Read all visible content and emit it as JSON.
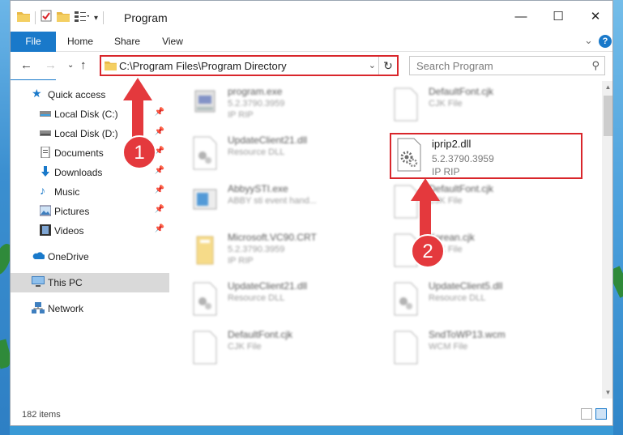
{
  "window": {
    "title": "Program",
    "controls": {
      "minimize": "—",
      "maximize": "☐",
      "close": "✕"
    }
  },
  "ribbon": {
    "tabs": [
      "File",
      "Home",
      "Share",
      "View"
    ],
    "help": "?"
  },
  "nav": {
    "address": "C:\\Program Files\\Program Directory",
    "search_placeholder": "Search Program"
  },
  "sidebar": {
    "items": [
      {
        "label": "Quick access",
        "icon": "star-icon"
      },
      {
        "label": "Local Disk (C:)",
        "icon": "drive-icon"
      },
      {
        "label": "Local Disk (D:)",
        "icon": "drive-icon"
      },
      {
        "label": "Documents",
        "icon": "documents-icon"
      },
      {
        "label": "Downloads",
        "icon": "download-icon"
      },
      {
        "label": "Music",
        "icon": "music-icon"
      },
      {
        "label": "Pictures",
        "icon": "pictures-icon"
      },
      {
        "label": "Videos",
        "icon": "videos-icon"
      },
      {
        "label": "OneDrive",
        "icon": "cloud-icon"
      },
      {
        "label": "This PC",
        "icon": "computer-icon"
      },
      {
        "label": "Network",
        "icon": "network-icon"
      }
    ]
  },
  "files": [
    {
      "name": "program.exe",
      "meta1": "5.2.3790.3959",
      "meta2": "IP RIP",
      "icon": "exe-icon"
    },
    {
      "name": "DefaultFont.cjk",
      "meta1": "CJK File",
      "meta2": "",
      "icon": "blank-file-icon"
    },
    {
      "name": "UpdateClient21.dll",
      "meta1": "Resource DLL",
      "meta2": "",
      "icon": "dll-icon"
    },
    {
      "name": "iprip2.dll",
      "meta1": "5.2.3790.3959",
      "meta2": "IP RIP",
      "icon": "dll-icon"
    },
    {
      "name": "AbbyySTI.exe",
      "meta1": "ABBY sti event hand...",
      "meta2": "",
      "icon": "exe-icon"
    },
    {
      "name": "DefaultFont.cjk",
      "meta1": "CJK File",
      "meta2": "",
      "icon": "blank-file-icon"
    },
    {
      "name": "Microsoft.VC90.CRT",
      "meta1": "5.2.3790.3959",
      "meta2": "IP RIP",
      "icon": "folder-icon"
    },
    {
      "name": "Korean.cjk",
      "meta1": "CJK File",
      "meta2": "",
      "icon": "blank-file-icon"
    },
    {
      "name": "UpdateClient21.dll",
      "meta1": "Resource DLL",
      "meta2": "",
      "icon": "dll-icon"
    },
    {
      "name": "UpdateClient5.dll",
      "meta1": "Resource DLL",
      "meta2": "",
      "icon": "dll-icon"
    },
    {
      "name": "DefaultFont.cjk",
      "meta1": "CJK File",
      "meta2": "",
      "icon": "blank-file-icon"
    },
    {
      "name": "SndToWP13.wcm",
      "meta1": "WCM File",
      "meta2": "",
      "icon": "blank-file-icon"
    }
  ],
  "status": {
    "count": "182 items"
  },
  "annotations": {
    "step1": "1",
    "step2": "2"
  },
  "colors": {
    "accent": "#1979ca",
    "highlight": "#d9262b"
  }
}
